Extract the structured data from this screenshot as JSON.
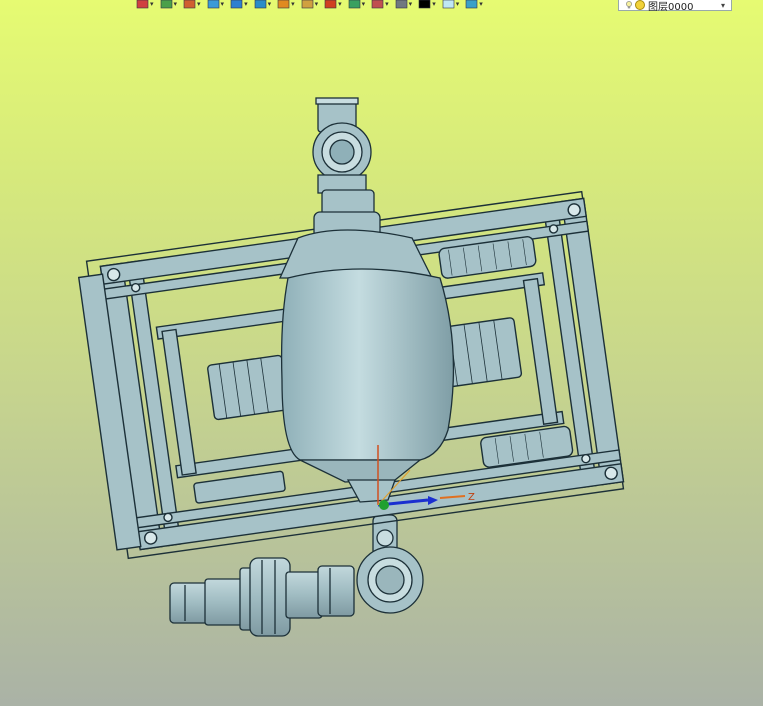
{
  "toolbar": {
    "buttons": [
      {
        "icon": "insert-component-icon",
        "color": "#d04040"
      },
      {
        "icon": "layers-stack-icon",
        "color": "#4aa04a"
      },
      {
        "icon": "sketch-pencil-icon",
        "color": "#d06030"
      },
      {
        "icon": "solid-box-icon",
        "color": "#3a9ad8"
      },
      {
        "icon": "blue-cube-icon",
        "color": "#2f7fd0"
      },
      {
        "icon": "assembly-cubes-icon",
        "color": "#2b8cc8"
      },
      {
        "icon": "render-shading-icon",
        "color": "#e08a20"
      },
      {
        "icon": "image-frame-icon",
        "color": "#d0a040"
      },
      {
        "icon": "pivot-point-icon",
        "color": "#d04020"
      },
      {
        "icon": "page-document-icon",
        "color": "#3aa060"
      },
      {
        "icon": "clipboard-icon",
        "color": "#c05050"
      },
      {
        "icon": "cylinder-icon",
        "color": "#707880"
      },
      {
        "icon": "black-square-icon",
        "color": "#000000"
      },
      {
        "icon": "light-panel-icon",
        "color": "#bfe7f5"
      },
      {
        "icon": "layer-sheets-icon",
        "color": "#3aa0c8"
      }
    ],
    "layer": {
      "label": "图层0000",
      "icon": "lightbulb-icon"
    }
  },
  "viewport": {
    "background_top": "#e6fb72",
    "background_bottom": "#aab2a6",
    "model_color": "#a6c2c8",
    "edge_color": "#1c3038",
    "triad_axis": "Z"
  }
}
